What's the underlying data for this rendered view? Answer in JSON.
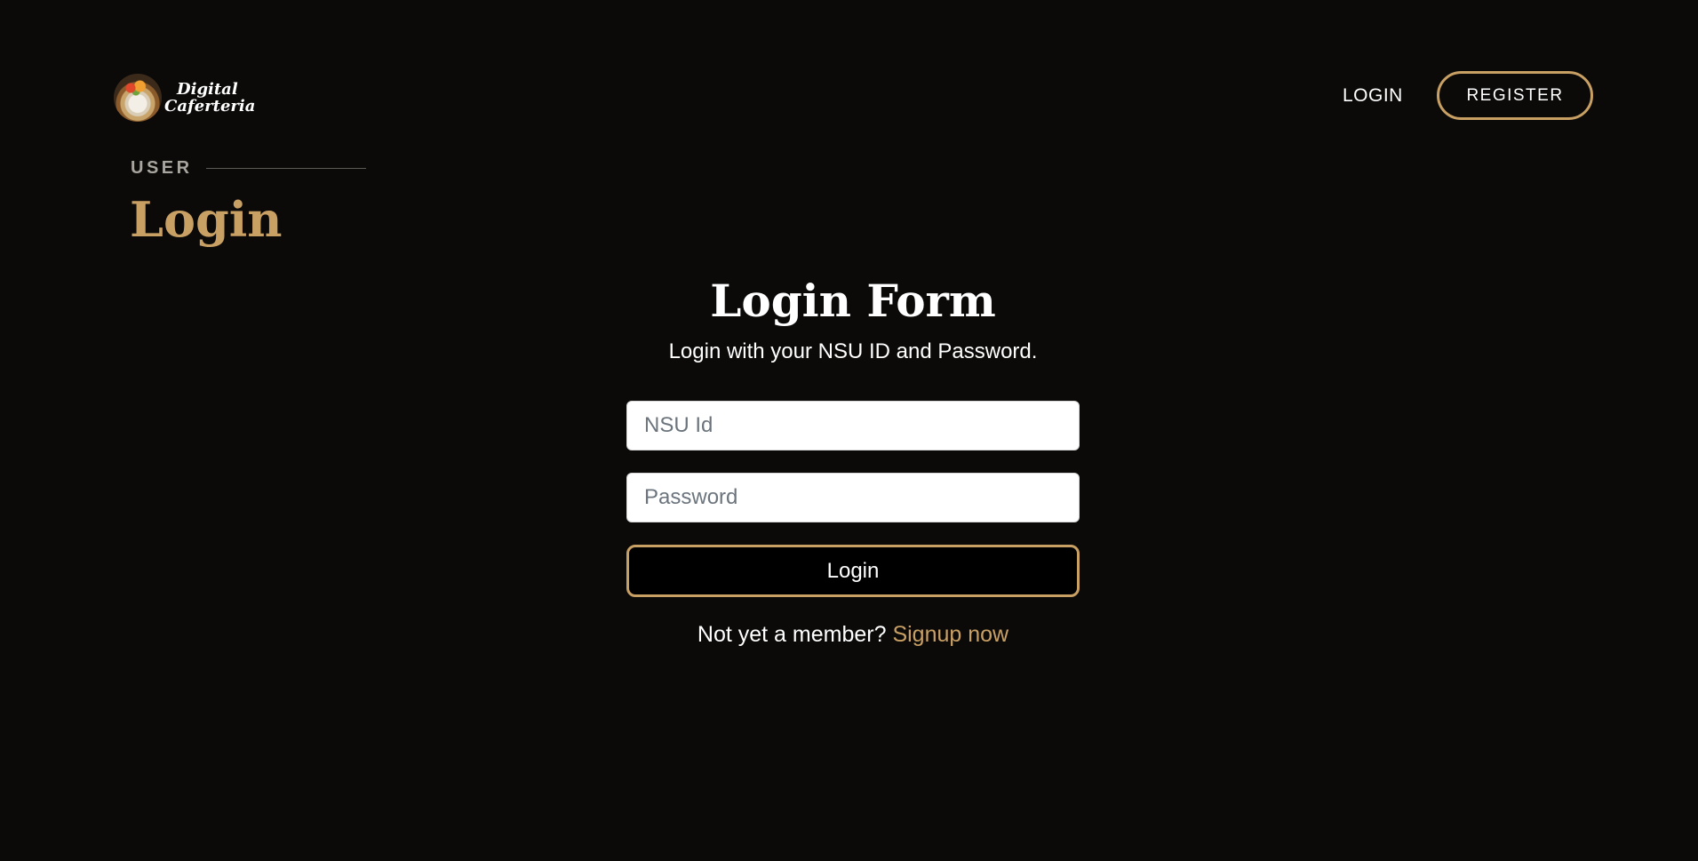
{
  "header": {
    "logo": {
      "line1": "Digital",
      "line2": "Caferteria"
    },
    "nav": {
      "login_label": "LOGIN",
      "register_label": "REGISTER"
    }
  },
  "hero": {
    "eyebrow": "USER",
    "title": "Login"
  },
  "login_form": {
    "title": "Login Form",
    "subtitle": "Login with your NSU ID and Password.",
    "nsu_id": {
      "value": "",
      "placeholder": "NSU Id"
    },
    "password": {
      "value": "",
      "placeholder": "Password"
    },
    "submit_label": "Login",
    "signup_prompt": "Not yet a member?",
    "signup_link": "Signup now"
  },
  "colors": {
    "background": "#0b0a09",
    "accent": "#c9a064",
    "text": "#ffffff"
  }
}
